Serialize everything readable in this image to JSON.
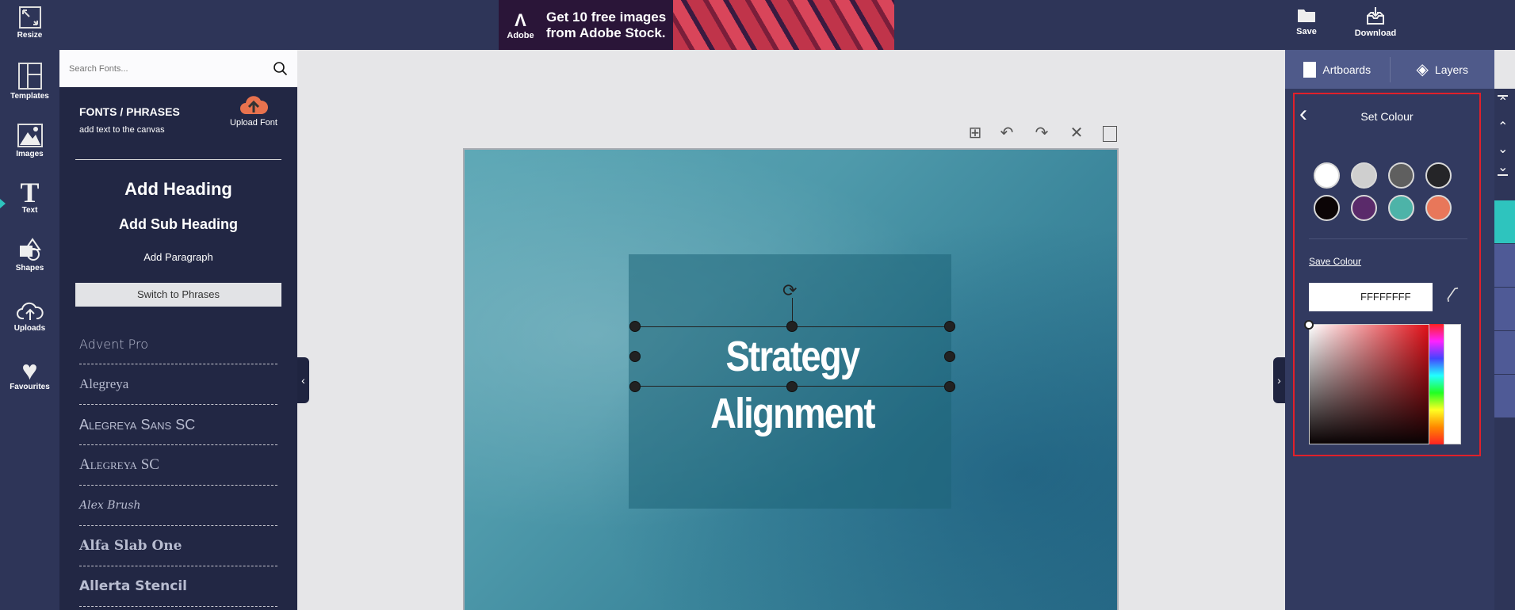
{
  "ad": {
    "brand": "Adobe",
    "text_line1": "Get 10 free images",
    "text_line2": "from Adobe Stock."
  },
  "topbar": {
    "save": "Save",
    "download": "Download"
  },
  "rail": [
    {
      "label": "Resize",
      "icon": "resize-icon"
    },
    {
      "label": "Templates",
      "icon": "templates-icon"
    },
    {
      "label": "Images",
      "icon": "images-icon"
    },
    {
      "label": "Text",
      "icon": "text-icon",
      "active": true
    },
    {
      "label": "Shapes",
      "icon": "shapes-icon"
    },
    {
      "label": "Uploads",
      "icon": "upload-cloud-icon"
    },
    {
      "label": "Favourites",
      "icon": "heart-icon"
    }
  ],
  "panel": {
    "search_placeholder": "Search Fonts...",
    "title": "FONTS / PHRASES",
    "subtitle": "add text to the canvas",
    "upload_font": "Upload Font",
    "add_heading": "Add Heading",
    "add_subheading": "Add Sub Heading",
    "add_paragraph": "Add Paragraph",
    "switch": "Switch to Phrases",
    "fonts": [
      "Advent Pro",
      "Alegreya",
      "Alegreya Sans SC",
      "Alegreya SC",
      "Alex Brush",
      "Alfa Slab One",
      "Allerta Stencil"
    ]
  },
  "canvas": {
    "text": "Strategy Alignment"
  },
  "right": {
    "artboards": "Artboards",
    "layers": "Layers",
    "set_colour": "Set Colour",
    "save_colour": "Save Colour",
    "hex": "FFFFFFFF",
    "swatches": [
      "#ffffff",
      "#cfcfcf",
      "#5f5f5f",
      "#252528",
      "#0c0506",
      "#5a2a6a",
      "#4db3a8",
      "#e8775a"
    ]
  },
  "colors": {
    "accent": "#2ec4be",
    "topbar": "#2e3558",
    "panel": "#222744",
    "highlight": "#e0202a"
  }
}
